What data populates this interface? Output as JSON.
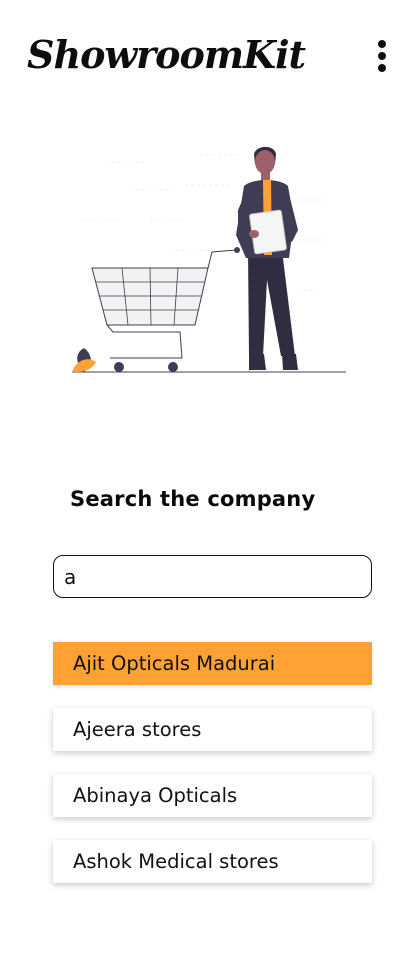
{
  "app": {
    "title": "ShowroomKit"
  },
  "header": {
    "menu_icon": "more-vert-icon"
  },
  "illustration": {
    "name": "shopping-person-with-cart",
    "colors": {
      "accent": "#ffa233",
      "dark": "#3f3d56",
      "grid": "#e6e6e6"
    }
  },
  "search": {
    "heading": "Search the company",
    "value": "a",
    "placeholder": ""
  },
  "results": [
    {
      "label": "Ajit Opticals Madurai",
      "active": true
    },
    {
      "label": "Ajeera stores",
      "active": false
    },
    {
      "label": "Abinaya Opticals",
      "active": false
    },
    {
      "label": "Ashok Medical stores",
      "active": false
    }
  ],
  "colors": {
    "highlight": "#ffa233",
    "text": "#111111",
    "background": "#ffffff"
  }
}
